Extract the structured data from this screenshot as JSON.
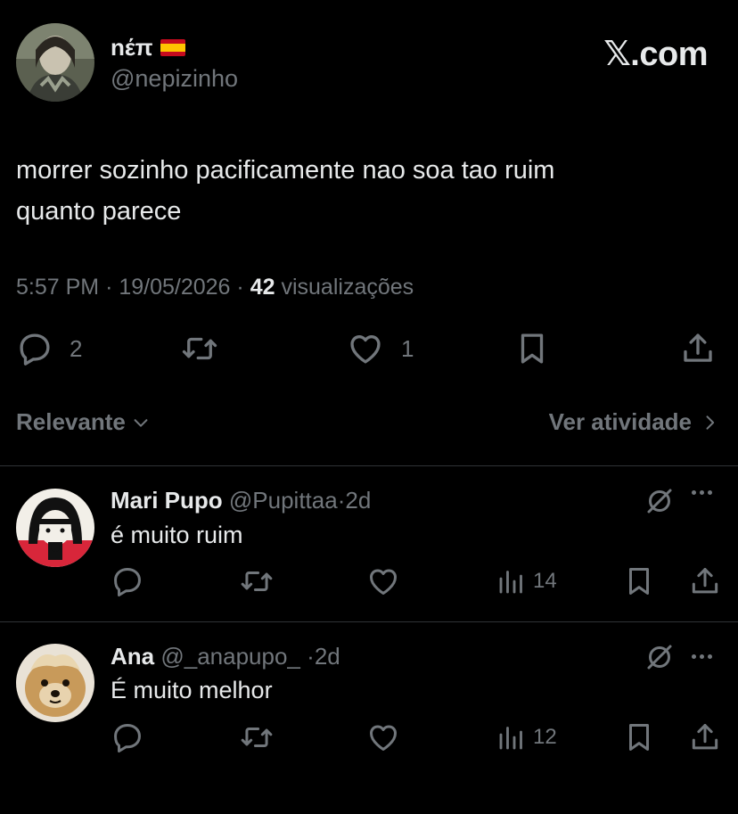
{
  "post": {
    "author_name": "nέπ",
    "author_flag": "🇪🇸",
    "author_handle": "@nepizinho",
    "site_brand": "𝕏.com",
    "text_line1": "morrer sozinho pacificamente nao soa tao ruim",
    "text_line2": "quanto parece",
    "time": "5:57 PM",
    "date": "19/05/2026",
    "views_count": "42",
    "views_label": "visualizações",
    "replies_count": "2",
    "likes_count": "1"
  },
  "sort": {
    "relevance_label": "Relevante",
    "activity_label": "Ver atividade"
  },
  "replies": [
    {
      "name": "Mari Pupo",
      "handle": "@Pupittaa",
      "age": "2d",
      "text": "é muito ruim",
      "views": "14"
    },
    {
      "name": "Ana",
      "handle": "@_anapupo_",
      "age": "2d",
      "text": "É muito melhor",
      "views": "12"
    }
  ],
  "colors": {
    "background": "#000000",
    "text_primary": "#e7e9ea",
    "text_secondary": "#71767b",
    "divider": "#2f3336"
  }
}
